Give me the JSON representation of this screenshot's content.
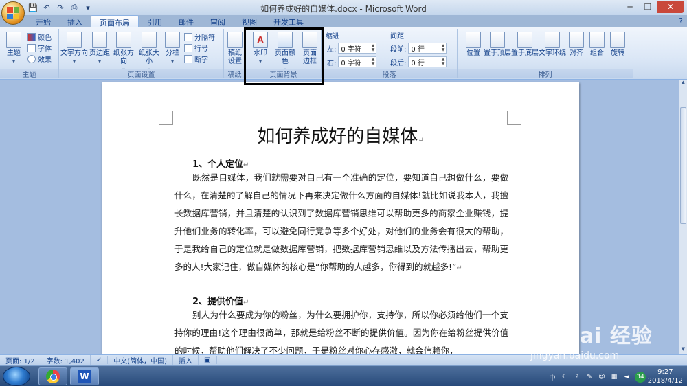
{
  "window": {
    "title": "如何养成好的自媒体.docx - Microsoft Word"
  },
  "tabs": [
    {
      "label": "开始"
    },
    {
      "label": "插入"
    },
    {
      "label": "页面布局"
    },
    {
      "label": "引用"
    },
    {
      "label": "邮件"
    },
    {
      "label": "审阅"
    },
    {
      "label": "视图"
    },
    {
      "label": "开发工具"
    }
  ],
  "ribbon": {
    "theme": {
      "label": "主题",
      "big_label": "主题",
      "colors": "颜色",
      "fonts": "字体",
      "effects": "效果"
    },
    "page_setup": {
      "label": "页面设置",
      "text_direction": "文字方向",
      "margins": "页边距",
      "orientation": "纸张方向",
      "size": "纸张大小",
      "columns": "分栏",
      "breaks": "分隔符",
      "line_numbers": "行号",
      "hyphenation": "断字"
    },
    "draft": {
      "label": "稿纸",
      "big_label_1": "稿纸",
      "big_label_2": "设置"
    },
    "page_background": {
      "label": "页面背景",
      "watermark": "水印",
      "page_color": "页面颜色",
      "page_border_1": "页面",
      "page_border_2": "边框"
    },
    "paragraph": {
      "label": "段落",
      "indent": "缩进",
      "spacing": "间距",
      "left_label": "左:",
      "left_value": "0 字符",
      "right_label": "右:",
      "right_value": "0 字符",
      "before_label": "段前:",
      "before_value": "0 行",
      "after_label": "段后:",
      "after_value": "0 行"
    },
    "arrange": {
      "label": "排列",
      "position": "位置",
      "bring_front": "置于顶层",
      "send_back": "置于底层",
      "text_wrap": "文字环绕",
      "align": "对齐",
      "group": "组合",
      "rotate": "旋转"
    }
  },
  "document": {
    "title": "如何养成好的自媒体",
    "sections": [
      {
        "heading": "1、个人定位",
        "body": "既然是自媒体，我们就需要对自己有一个准确的定位，要知道自己想做什么，要做什么，在清楚的了解自己的情况下再来决定做什么方面的自媒体!就比如说我本人，我擅长数据库营销，并且清楚的认识到了数据库营销思维可以帮助更多的商家企业赚钱，提升他们业务的转化率，可以避免同行竞争等多个好处，对他们的业务会有很大的帮助，于是我给自己的定位就是做数据库营销，把数据库营销思维以及方法传播出去，帮助更多的人!大家记住，做自媒体的核心是“你帮助的人越多，你得到的就越多!”"
      },
      {
        "heading": "2、提供价值",
        "body": "别人为什么要成为你的粉丝，为什么要拥护你，支持你，所以你必须给他们一个支持你的理由!这个理由很简单，那就是给粉丝不断的提供价值。因为你在给粉丝提供价值的时候，帮助他们解决了不少问题，于是粉丝对你心存感激，就会信赖你，"
      }
    ],
    "para_mark": "↵"
  },
  "statusbar": {
    "page": "页面: 1/2",
    "words": "字数: 1,402",
    "language": "中文(简体，中国)",
    "insert": "插入"
  },
  "taskbar": {
    "time": "9:27",
    "date": "2018/4/12",
    "badge": "34",
    "ime": "中"
  },
  "watermark": {
    "text": "Bai 经验",
    "sub": "jingyan.baidu.com"
  }
}
